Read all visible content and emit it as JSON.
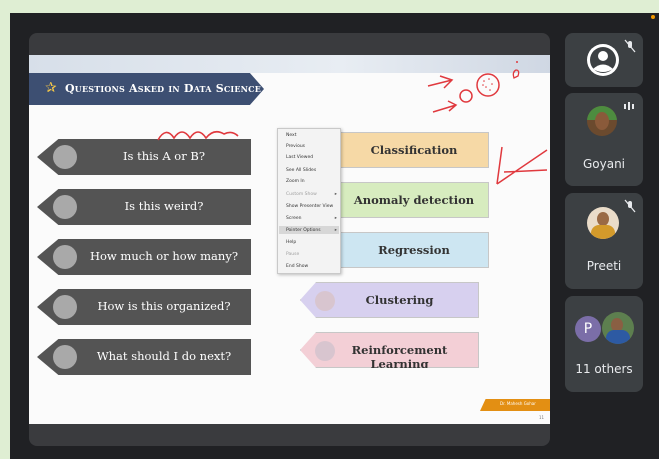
{
  "slide": {
    "title": "Questions Asked in Data Science",
    "questions": [
      "Is this A or B?",
      "Is this weird?",
      "How much or how many?",
      "How is this organized?",
      "What should I do next?"
    ],
    "answers": [
      "Classification",
      "Anomaly detection",
      "Regression",
      "Clustering",
      "Reinforcement Learning"
    ],
    "answer_colors": [
      "#f6d9a6",
      "#d7ecbf",
      "#cde6f2",
      "#d7d0ef",
      "#f3cfd6"
    ],
    "footer_author": "Dr. Mahesh Gohar",
    "page_number": "11"
  },
  "context_menu": {
    "items": [
      "Next",
      "Previous",
      "Last Viewed",
      "See All Slides",
      "Zoom In",
      "Custom Show",
      "Show Presenter View",
      "Screen",
      "Pointer Options",
      "Help",
      "Pause",
      "End Show"
    ]
  },
  "participants": [
    {
      "name": "",
      "icon": "account-circle-icon",
      "muted": true
    },
    {
      "name": "Goyani",
      "icon": "speaking-icon",
      "muted": false
    },
    {
      "name": "Preeti",
      "icon": "mic-off-icon",
      "muted": true
    },
    {
      "name": "11 others",
      "initial": "P",
      "muted": false
    }
  ],
  "colors": {
    "title_band": "#3d4f72",
    "question_box": "#545454",
    "annotation_ink": "#e0393e",
    "footer_band": "#e38f13"
  }
}
